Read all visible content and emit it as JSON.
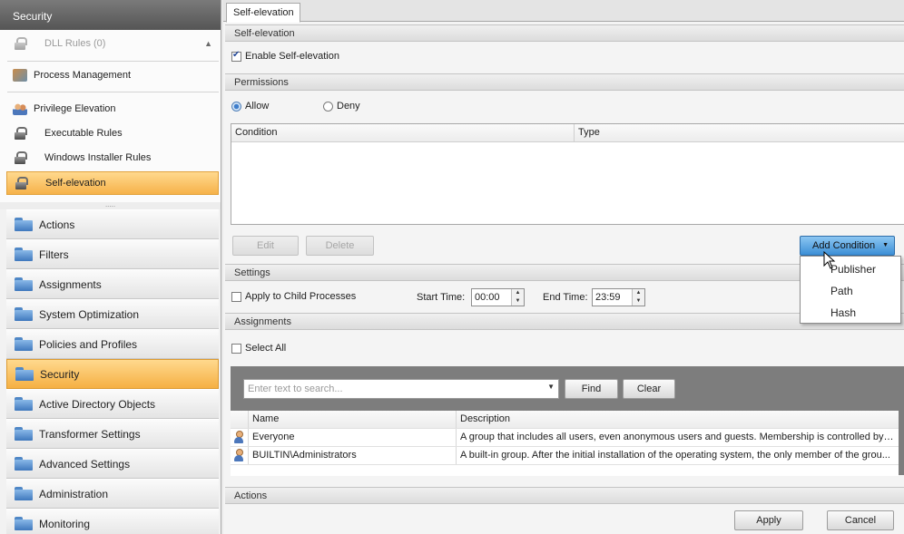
{
  "sidebar": {
    "header": "Security",
    "tree": [
      {
        "label": "DLL Rules (0)",
        "icon": "lock-icon"
      },
      {
        "label": "Process Management",
        "icon": "process-icon"
      },
      {
        "label": "Privilege Elevation",
        "icon": "users-icon"
      },
      {
        "label": "Executable Rules",
        "icon": "lock-icon"
      },
      {
        "label": "Windows Installer Rules",
        "icon": "lock-icon"
      },
      {
        "label": "Self-elevation",
        "icon": "lock-icon"
      }
    ],
    "nav": [
      "Actions",
      "Filters",
      "Assignments",
      "System Optimization",
      "Policies and Profiles",
      "Security",
      "Active Directory Objects",
      "Transformer Settings",
      "Advanced Settings",
      "Administration",
      "Monitoring"
    ],
    "active_nav": "Security",
    "grip": "....."
  },
  "main": {
    "tab": "Self-elevation",
    "self_elevation": {
      "header": "Self-elevation",
      "enable_label": "Enable Self-elevation",
      "enabled": true
    },
    "permissions": {
      "header": "Permissions",
      "allow_label": "Allow",
      "deny_label": "Deny",
      "selected": "Allow",
      "columns": [
        "Condition",
        "Type"
      ],
      "edit_label": "Edit",
      "delete_label": "Delete",
      "add_condition_label": "Add Condition",
      "dropdown": [
        "Publisher",
        "Path",
        "Hash"
      ]
    },
    "settings": {
      "header": "Settings",
      "child_label": "Apply to Child Processes",
      "start_label": "Start Time:",
      "start_value": "00:00",
      "end_label": "End Time:",
      "end_value": "23:59"
    },
    "assignments": {
      "header": "Assignments",
      "select_all_label": "Select All",
      "search_placeholder": "Enter text to search...",
      "find_label": "Find",
      "clear_label": "Clear",
      "columns": [
        "Name",
        "Description"
      ],
      "rows": [
        {
          "name": "Everyone",
          "description": "A group that includes all users, even anonymous users and guests. Membership is controlled by t..."
        },
        {
          "name": "BUILTIN\\Administrators",
          "description": "A built-in group. After the initial installation of the operating system, the only member of the grou..."
        }
      ]
    },
    "actions": {
      "header": "Actions",
      "apply_label": "Apply",
      "cancel_label": "Cancel"
    }
  },
  "colors": {
    "accent_orange": "#f6b24a",
    "primary_blue": "#3c8fd6"
  }
}
